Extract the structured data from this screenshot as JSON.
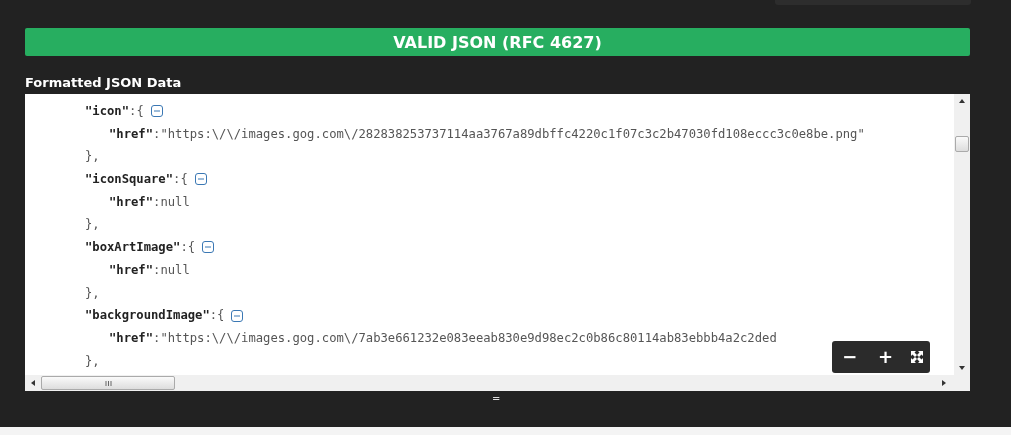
{
  "banner": "VALID JSON (RFC 4627)",
  "section_title": "Formatted JSON Data",
  "objects": [
    {
      "key": "\"icon\"",
      "sep": ":",
      "open": "{",
      "expanded": true,
      "close": "},",
      "children": [
        {
          "key": "\"href\"",
          "sep": ":",
          "value": "\"https:\\/\\/images.gog.com\\/282838253737114aa3767a89dbffc4220c1f07c3c2b47030fd108eccc3c0e8be.png\""
        }
      ]
    },
    {
      "key": "\"iconSquare\"",
      "sep": ":",
      "open": "{",
      "expanded": true,
      "close": "},",
      "children": [
        {
          "key": "\"href\"",
          "sep": ":",
          "value": "null"
        }
      ]
    },
    {
      "key": "\"boxArtImage\"",
      "sep": ":",
      "open": "{",
      "expanded": true,
      "close": "},",
      "children": [
        {
          "key": "\"href\"",
          "sep": ":",
          "value": "null"
        }
      ]
    },
    {
      "key": "\"backgroundImage\"",
      "sep": ":",
      "open": "{",
      "expanded": true,
      "close": "},",
      "children": [
        {
          "key": "\"href\"",
          "sep": ":",
          "value": "\"https:\\/\\/images.gog.com\\/7ab3e661232e083eeab830e9d98ec2c0b86c80114ab83ebbb4a2c2ded"
        }
      ]
    }
  ],
  "zoom_controls": [
    "−",
    "+"
  ],
  "resize_handle": "="
}
